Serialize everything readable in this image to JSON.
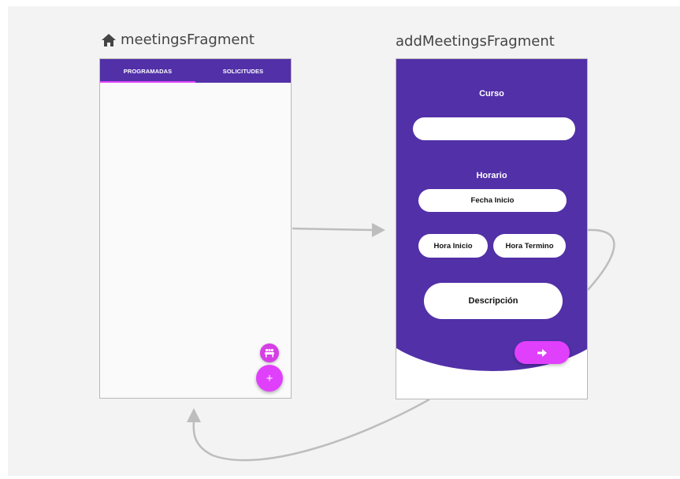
{
  "screens": {
    "meetings": {
      "title": "meetingsFragment",
      "tabs": [
        {
          "label": "PROGRAMADAS",
          "active": true
        },
        {
          "label": "SOLICITUDES",
          "active": false
        }
      ],
      "fab_small_icon": "group-icon",
      "fab_icon": "plus-icon",
      "fab_label": "+"
    },
    "add_meetings": {
      "title": "addMeetingsFragment",
      "curso_label": "Curso",
      "curso_value": "",
      "horario_label": "Horario",
      "fecha_inicio": "Fecha Inicio",
      "hora_inicio": "Hora Inicio",
      "hora_termino": "Hora Termino",
      "descripcion": "Descripción",
      "next_icon": "arrow-right-icon"
    }
  },
  "colors": {
    "primary": "#5230a8",
    "accent": "#e040fb",
    "background": "#f3f3f3",
    "connector": "#bdbdbd"
  }
}
